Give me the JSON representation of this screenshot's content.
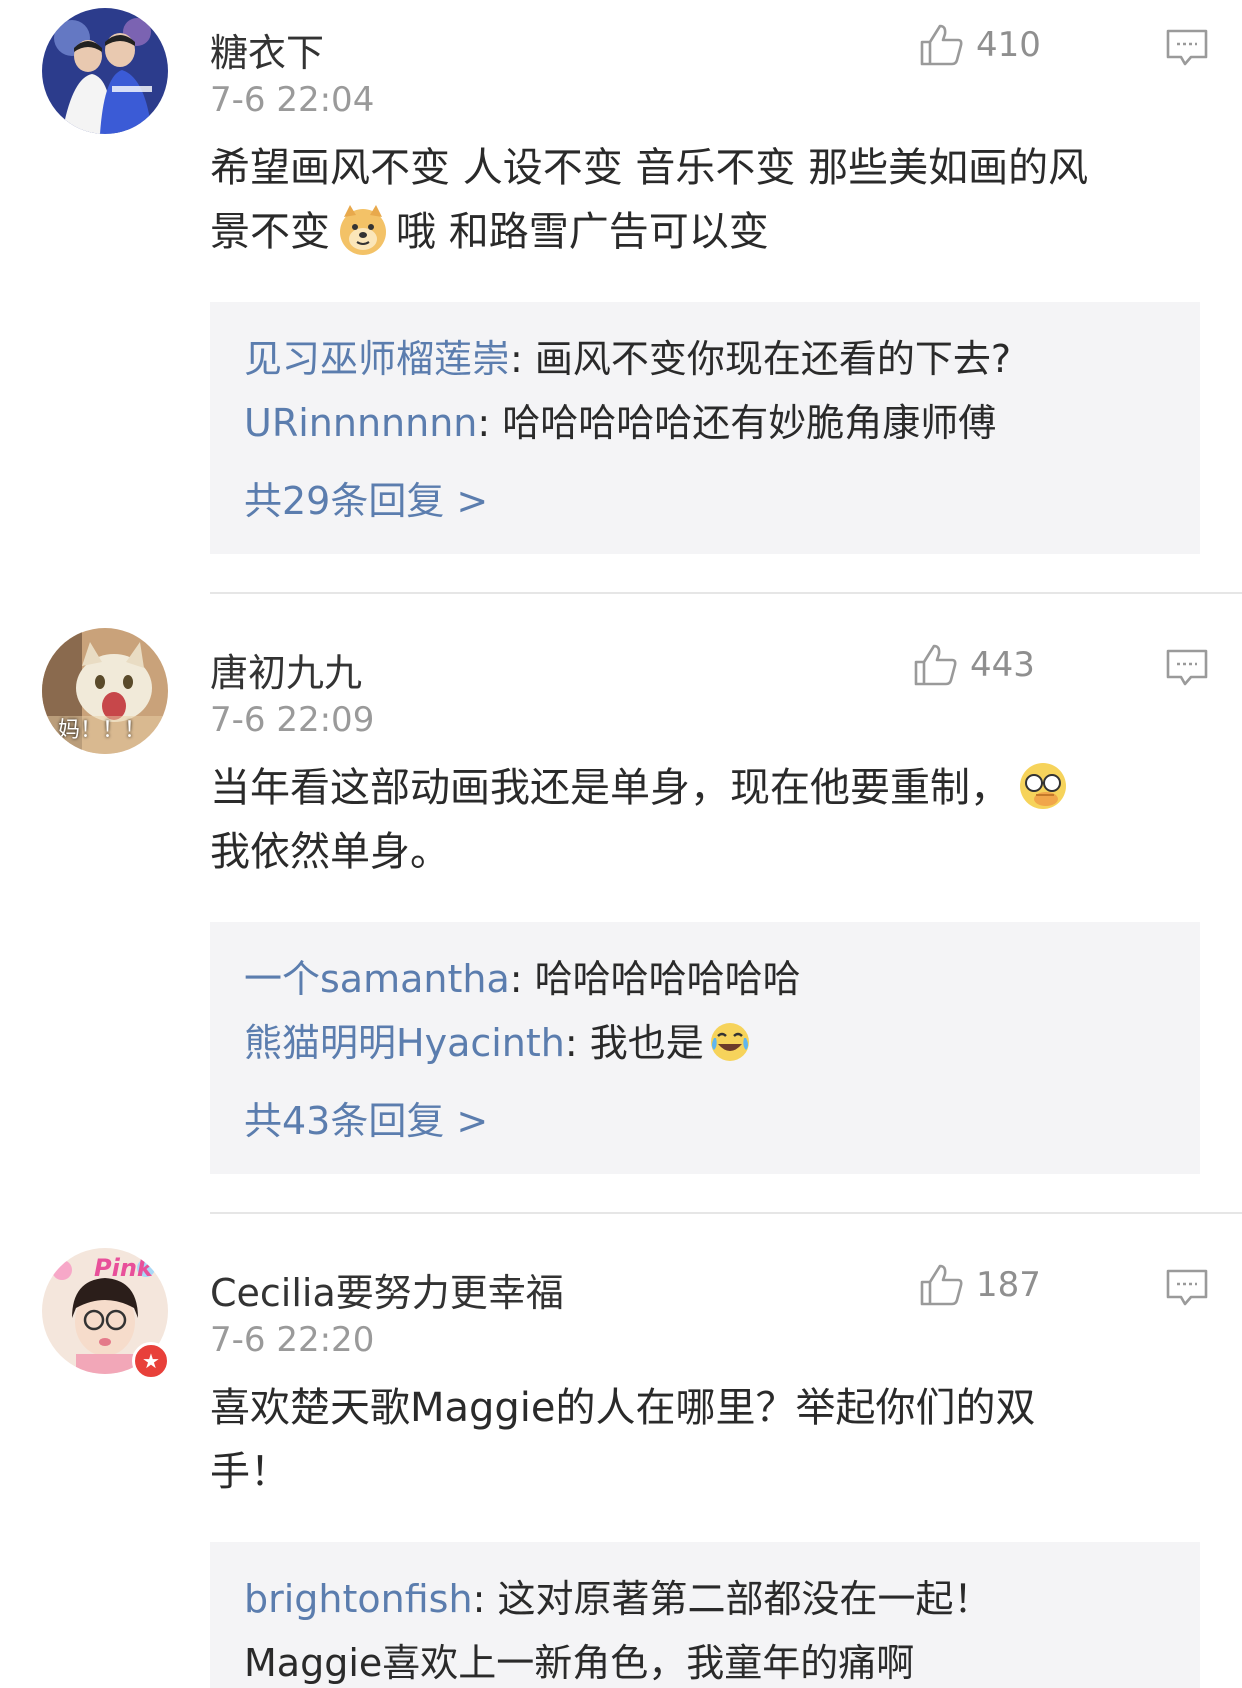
{
  "colors": {
    "link": "#5b7dae",
    "muted": "#9a9a9a",
    "reply_bg": "#f4f4f6"
  },
  "comments": [
    {
      "username": "糖衣下",
      "time": "7-6 22:04",
      "likes": "410",
      "text_line1": "希望画风不变 人设不变 音乐不变 那些美如画的风",
      "text_line2a": "景不变",
      "emoji": "doge-emoji",
      "text_line2b": "哦 和路雪广告可以变",
      "replies": [
        {
          "name": "见习巫师榴莲崇",
          "sep": ": ",
          "text": "画风不变你现在还看的下去?"
        },
        {
          "name": "URinnnnnnn",
          "sep": ": ",
          "text": "哈哈哈哈哈还有妙脆角康师傅"
        }
      ],
      "more": "共29条回复 >"
    },
    {
      "username": "唐初九九",
      "time": "7-6 22:09",
      "likes": "443",
      "avatar_text": "妈！！！",
      "text_line1": "当年看这部动画我还是单身，现在他要重制，",
      "emoji": "facepalm-emoji",
      "text_line2": "我依然单身。",
      "replies": [
        {
          "name": "一个samantha",
          "sep": ": ",
          "text": "哈哈哈哈哈哈哈"
        },
        {
          "name": "熊猫明明Hyacinth",
          "sep": ": ",
          "text": "我也是",
          "emoji": "laugh-cry-emoji"
        }
      ],
      "more": "共43条回复 >"
    },
    {
      "username": "Cecilia要努力更幸福",
      "time": "7-6 22:20",
      "likes": "187",
      "avatar_text": "Pink",
      "text_line1": "喜欢楚天歌Maggie的人在哪里？举起你们的双",
      "text_line2": "手！",
      "replies": [
        {
          "name": "brightonfish",
          "sep": ": ",
          "text": "这对原著第二部都没在一起！"
        },
        {
          "name": "",
          "sep": "",
          "text": "Maggie喜欢上一新角色，我童年的痛啊"
        }
      ]
    }
  ]
}
